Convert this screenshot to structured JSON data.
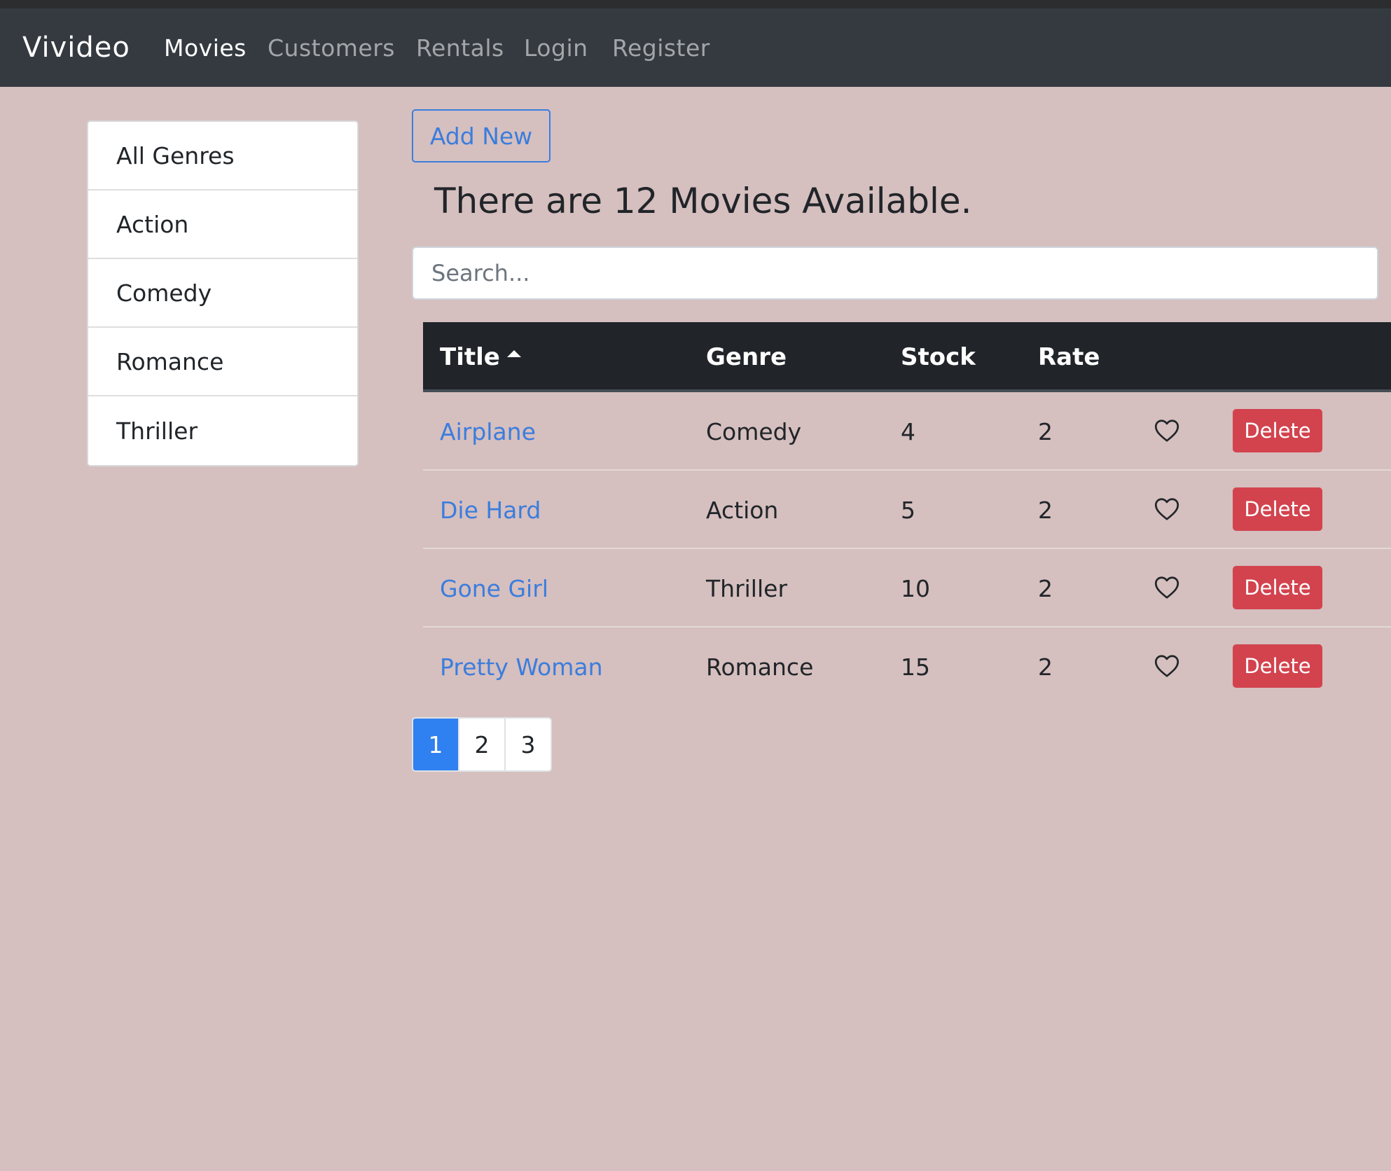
{
  "navbar": {
    "brand": "Vivideo",
    "links": [
      {
        "label": "Movies",
        "active": true
      },
      {
        "label": "Customers",
        "active": false
      },
      {
        "label": "Rentals",
        "active": false
      },
      {
        "label": "Login",
        "active": false
      },
      {
        "label": "Register",
        "active": false
      }
    ]
  },
  "genres": [
    "All Genres",
    "Action",
    "Comedy",
    "Romance",
    "Thriller"
  ],
  "main": {
    "add_button": "Add New",
    "count_heading": "There are 12 Movies Available.",
    "search_placeholder": "Search..."
  },
  "table": {
    "columns": [
      "Title",
      "Genre",
      "Stock",
      "Rate"
    ],
    "sorted_column": "Title",
    "sort_direction": "asc",
    "rows": [
      {
        "title": "Airplane",
        "genre": "Comedy",
        "stock": "4",
        "rate": "2",
        "delete": "Delete"
      },
      {
        "title": "Die Hard",
        "genre": "Action",
        "stock": "5",
        "rate": "2",
        "delete": "Delete"
      },
      {
        "title": "Gone Girl",
        "genre": "Thriller",
        "stock": "10",
        "rate": "2",
        "delete": "Delete"
      },
      {
        "title": "Pretty Woman",
        "genre": "Romance",
        "stock": "15",
        "rate": "2",
        "delete": "Delete"
      }
    ]
  },
  "pagination": {
    "pages": [
      "1",
      "2",
      "3"
    ],
    "current": "1"
  },
  "colors": {
    "background": "#d5bfbf",
    "navbar": "#343a40",
    "link": "#3b7ddd",
    "danger": "#d2434e",
    "active_page": "#2f80f0"
  },
  "icons": {
    "like": "heart-outline-icon",
    "sort": "caret-up-icon"
  }
}
